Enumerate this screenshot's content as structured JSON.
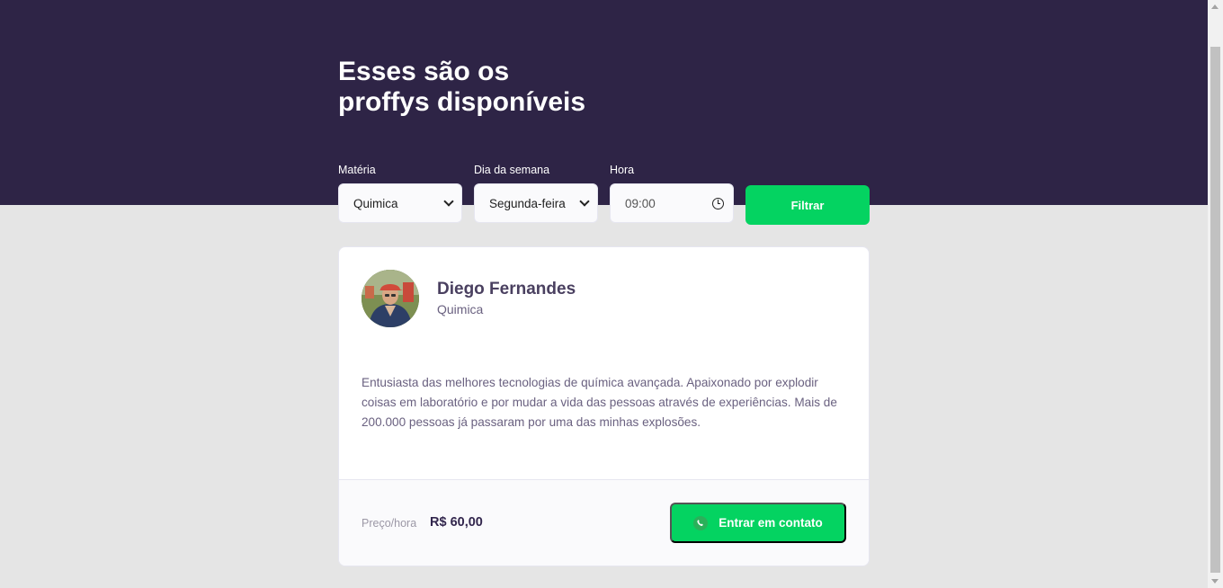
{
  "header": {
    "title_line1": "Esses são os",
    "title_line2": "proffys disponíveis"
  },
  "filters": {
    "subject_label": "Matéria",
    "subject_value": "Quimica",
    "weekday_label": "Dia da semana",
    "weekday_value": "Segunda-feira",
    "time_label": "Hora",
    "time_value": "09:00",
    "filter_button": "Filtrar"
  },
  "teacher": {
    "name": "Diego Fernandes",
    "subject": "Quimica",
    "bio": "Entusiasta das melhores tecnologias de química avançada. Apaixonado por explodir coisas em laboratório e por mudar a vida das pessoas através de experiências. Mais de 200.000 pessoas já passaram por uma das minhas explosões.",
    "price_label": "Preço/hora",
    "price": "R$ 60,00",
    "contact_button": "Entrar em contato"
  },
  "colors": {
    "header_bg": "#2e2446",
    "page_bg": "#e5e5e5",
    "accent_green": "#04d361",
    "text_dark": "#32264d"
  },
  "icons": {
    "select_chevron": "chevron-down-icon",
    "time": "clock-icon",
    "contact": "whatsapp-icon"
  }
}
